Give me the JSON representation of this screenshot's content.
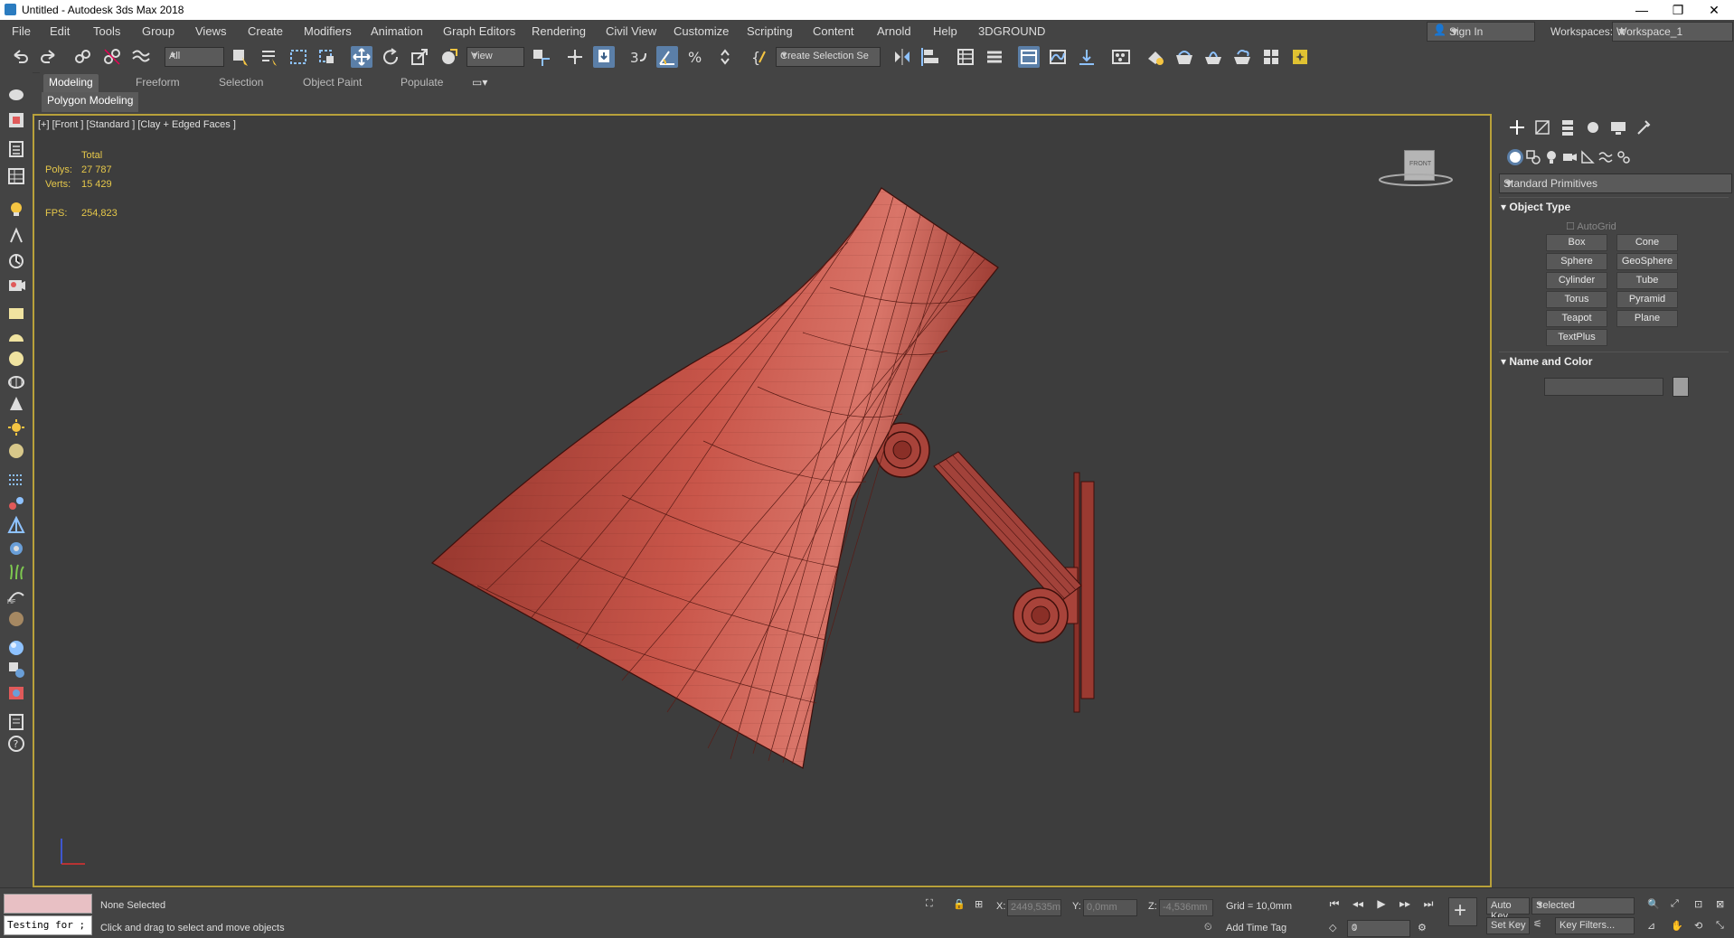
{
  "window": {
    "title": "Untitled - Autodesk 3ds Max 2018"
  },
  "menu": [
    "File",
    "Edit",
    "Tools",
    "Group",
    "Views",
    "Create",
    "Modifiers",
    "Animation",
    "Graph Editors",
    "Rendering",
    "Civil View",
    "Customize",
    "Scripting",
    "Content",
    "Arnold",
    "Help",
    "3DGROUND"
  ],
  "account": {
    "sign_in": "Sign In",
    "workspaces_label": "Workspaces:",
    "workspace": "Workspace_1"
  },
  "toolbar": {
    "filter": "All",
    "ref_coord": "View",
    "selection_set": "Create Selection Se"
  },
  "ribbon": {
    "tabs": [
      "Modeling",
      "Freeform",
      "Selection",
      "Object Paint",
      "Populate"
    ],
    "active_tab": "Modeling",
    "panel": "Polygon Modeling"
  },
  "viewport": {
    "label": "[+] [Front ] [Standard ] [Clay + Edged Faces ]",
    "stats": {
      "total_label": "Total",
      "polys_label": "Polys:",
      "polys": "27 787",
      "verts_label": "Verts:",
      "verts": "15 429",
      "fps_label": "FPS:",
      "fps": "254,823"
    },
    "viewcube": "FRONT"
  },
  "command_panel": {
    "category": "Standard Primitives",
    "object_type": {
      "title": "Object Type",
      "autogrid": "AutoGrid",
      "buttons": [
        "Box",
        "Cone",
        "Sphere",
        "GeoSphere",
        "Cylinder",
        "Tube",
        "Torus",
        "Pyramid",
        "Teapot",
        "Plane",
        "TextPlus"
      ]
    },
    "name_color": {
      "title": "Name and Color"
    }
  },
  "status": {
    "maxscript": "Testing for ;",
    "selection": "None Selected",
    "prompt": "Click and drag to select and move objects",
    "x_label": "X:",
    "x": "2449,535m",
    "y_label": "Y:",
    "y": "0,0mm",
    "z_label": "Z:",
    "z": "-4,536mm",
    "grid": "Grid = 10,0mm",
    "add_time_tag": "Add Time Tag",
    "auto_key": "Auto Key",
    "set_key": "Set Key",
    "key_mode": "Selected",
    "key_filters": "Key Filters...",
    "frame": "0"
  },
  "colors": {
    "accent_active": "#5b7fa8",
    "viewport_border": "#b8a13a",
    "stats": "#e6c84a",
    "model": "#b84a3f"
  }
}
